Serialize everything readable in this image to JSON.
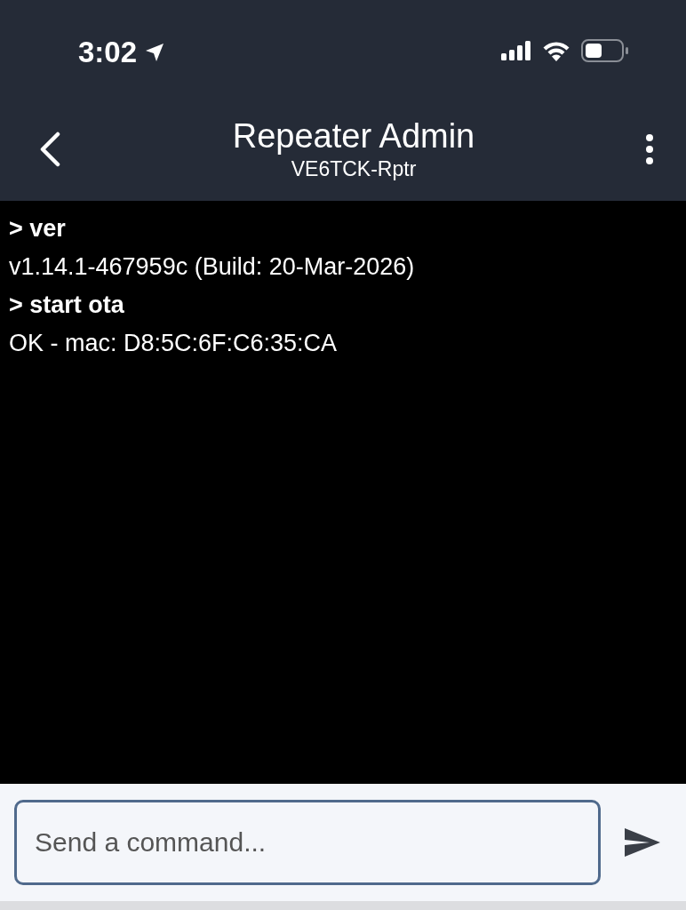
{
  "status_bar": {
    "time": "3:02"
  },
  "header": {
    "title": "Repeater Admin",
    "subtitle": "VE6TCK-Rptr"
  },
  "console": [
    {
      "kind": "command",
      "text": "> ver"
    },
    {
      "kind": "output",
      "text": "v1.14.1-467959c (Build: 20-Mar-2026)"
    },
    {
      "kind": "command",
      "text": "> start ota"
    },
    {
      "kind": "output",
      "text": "OK - mac: D8:5C:6F:C6:35:CA"
    }
  ],
  "input": {
    "placeholder": "Send a command..."
  }
}
